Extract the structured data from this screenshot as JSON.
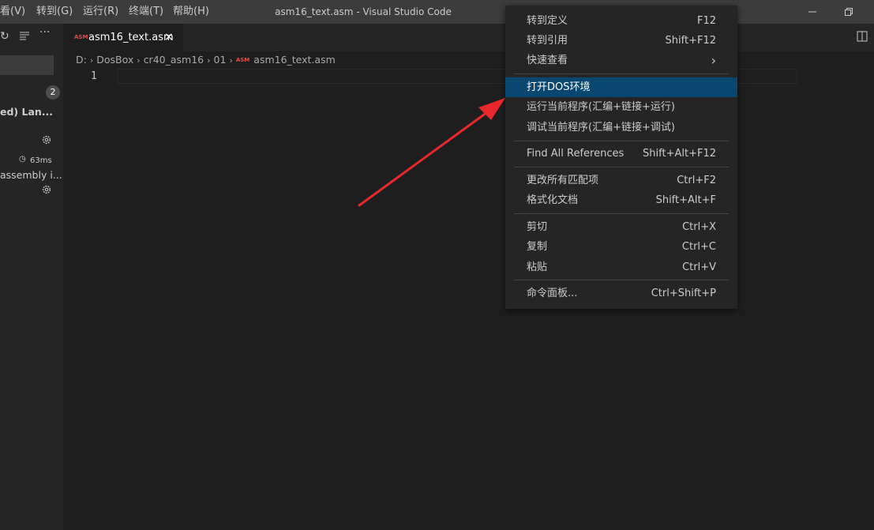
{
  "window": {
    "title": "asm16_text.asm - Visual Studio Code",
    "menu": [
      "查看(V)",
      "转到(G)",
      "运行(R)",
      "终端(T)",
      "帮助(H)"
    ],
    "menu_partial_first": "看(V)"
  },
  "sidebar": {
    "badge": "2",
    "ext1_title": "ed) Lan...",
    "ext2_time": "63ms",
    "ext2_desc": "assembly i..."
  },
  "tab": {
    "icon_text": "ASM",
    "label": "asm16_text.asm",
    "close": "×"
  },
  "breadcrumb": [
    "D:",
    "DosBox",
    "cr40_asm16",
    "01",
    "asm16_text.asm"
  ],
  "editor": {
    "line_number": "1"
  },
  "context_menu": {
    "items": [
      {
        "label": "转到定义",
        "key": "F12"
      },
      {
        "label": "转到引用",
        "key": "Shift+F12"
      },
      {
        "label": "快速查看",
        "key": "›"
      },
      {
        "label": "打开DOS环境",
        "key": ""
      },
      {
        "label": "运行当前程序(汇编+链接+运行)",
        "key": ""
      },
      {
        "label": "调试当前程序(汇编+链接+调试)",
        "key": ""
      },
      {
        "label": "Find All References",
        "key": "Shift+Alt+F12"
      },
      {
        "label": "更改所有匹配项",
        "key": "Ctrl+F2"
      },
      {
        "label": "格式化文档",
        "key": "Shift+Alt+F"
      },
      {
        "label": "剪切",
        "key": "Ctrl+X"
      },
      {
        "label": "复制",
        "key": "Ctrl+C"
      },
      {
        "label": "粘贴",
        "key": "Ctrl+V"
      },
      {
        "label": "命令面板...",
        "key": "Ctrl+Shift+P"
      }
    ]
  },
  "colors": {
    "accent_highlight": "#094771",
    "annotation_arrow": "#e8282b",
    "asm_icon": "#e44c4c"
  }
}
